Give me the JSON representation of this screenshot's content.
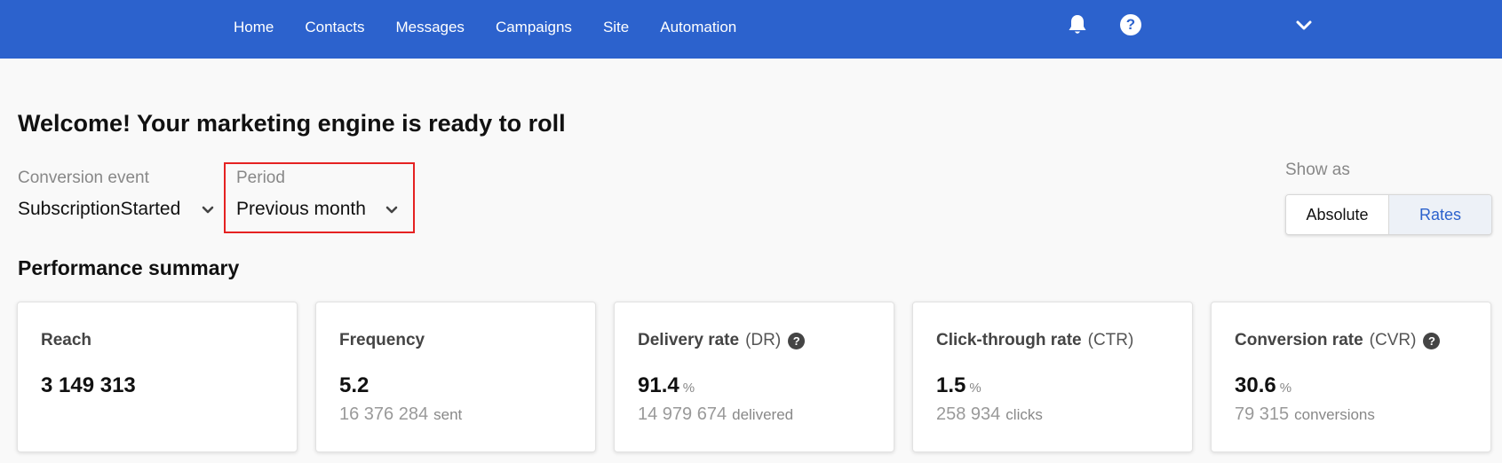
{
  "nav": {
    "items": [
      "Home",
      "Contacts",
      "Messages",
      "Campaigns",
      "Site",
      "Automation"
    ]
  },
  "icons": {
    "bell": "bell-icon",
    "help": "question-circle-icon",
    "help_glyph": "?",
    "account_menu": "chevron-down-icon"
  },
  "colors": {
    "brand": "#2c62cd",
    "highlight": "#e52222"
  },
  "page": {
    "title": "Welcome! Your marketing engine is ready to roll"
  },
  "filters": {
    "conversion_event": {
      "label": "Conversion event",
      "value": "SubscriptionStarted"
    },
    "period": {
      "label": "Period",
      "value": "Previous month"
    }
  },
  "show_as": {
    "label": "Show as",
    "options": [
      "Absolute",
      "Rates"
    ],
    "selected": "Rates"
  },
  "summary": {
    "title": "Performance summary",
    "cards": [
      {
        "title": "Reach",
        "abbr": "",
        "help": false,
        "value": "3 149 313",
        "unit": "",
        "sub_value": "",
        "sub_unit": ""
      },
      {
        "title": "Frequency",
        "abbr": "",
        "help": false,
        "value": "5.2",
        "unit": "",
        "sub_value": "16 376 284",
        "sub_unit": "sent"
      },
      {
        "title": "Delivery rate",
        "abbr": "(DR)",
        "help": true,
        "value": "91.4",
        "unit": "%",
        "sub_value": "14 979 674",
        "sub_unit": "delivered"
      },
      {
        "title": "Click-through rate",
        "abbr": "(CTR)",
        "help": false,
        "value": "1.5",
        "unit": "%",
        "sub_value": "258 934",
        "sub_unit": "clicks"
      },
      {
        "title": "Conversion rate",
        "abbr": "(CVR)",
        "help": true,
        "value": "30.6",
        "unit": "%",
        "sub_value": "79 315",
        "sub_unit": "conversions"
      }
    ]
  }
}
